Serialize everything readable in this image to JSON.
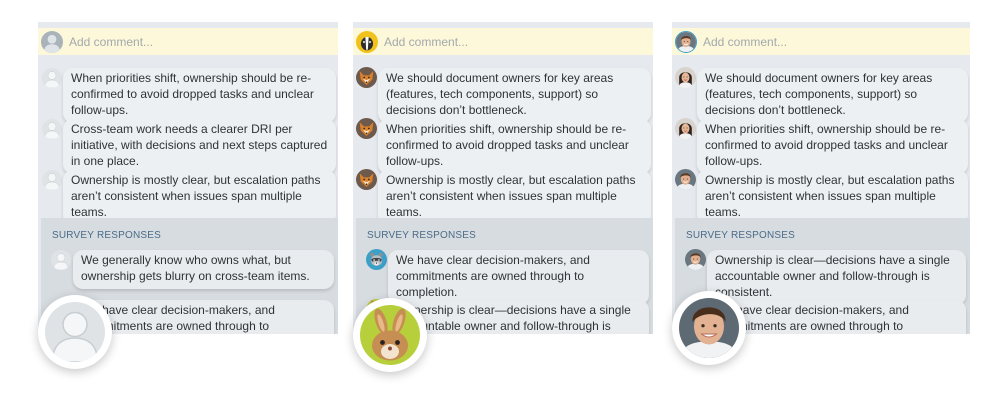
{
  "panels": [
    {
      "theme": "anonymous",
      "placeholder": "Add comment...",
      "comments": [
        {
          "avatar": "anonymous-avatar-icon",
          "text": "When priorities shift, ownership should be re-confirmed to avoid dropped tasks and unclear follow-ups."
        },
        {
          "avatar": "anonymous-avatar-icon",
          "text": "Cross-team work needs a clearer DRI per initiative, with decisions and next steps captured in one place."
        },
        {
          "avatar": "anonymous-avatar-icon",
          "text": "Ownership is mostly clear, but escalation paths aren’t consistent when issues span multiple teams."
        }
      ],
      "survey_label": "SURVEY RESPONSES",
      "survey": [
        {
          "avatar": "anonymous-avatar-icon",
          "text": "We generally know who owns what, but ownership gets blurry on cross-team items."
        },
        {
          "avatar": "anonymous-avatar-icon",
          "text": "We have clear decision-makers, and commitments are owned through to completion."
        }
      ]
    },
    {
      "theme": "animal",
      "placeholder": "Add comment...",
      "comments": [
        {
          "avatar": "fox-avatar-icon",
          "text": "We should document owners for key areas (features, tech components, support) so decisions don’t bottleneck."
        },
        {
          "avatar": "fox-avatar-icon",
          "text": "When priorities shift, ownership should be re-confirmed to avoid dropped tasks and unclear follow-ups."
        },
        {
          "avatar": "fox-avatar-icon",
          "text": "Ownership is mostly clear, but escalation paths aren’t consistent when issues span multiple teams."
        }
      ],
      "survey_label": "SURVEY RESPONSES",
      "survey": [
        {
          "avatar": "raccoon-avatar-icon",
          "text": "We have clear decision-makers, and commitments are owned through to completion."
        },
        {
          "avatar": "rabbit-avatar-icon",
          "text": "Ownership is clear—decisions have a single accountable owner and follow-through is consistent."
        }
      ]
    },
    {
      "theme": "photo",
      "placeholder": "Add comment...",
      "comments": [
        {
          "avatar": "woman-photo-avatar-icon",
          "text": "We should document owners for key areas (features, tech components, support) so decisions don’t bottleneck."
        },
        {
          "avatar": "woman-photo-avatar-icon",
          "text": "When priorities shift, ownership should be re-confirmed to avoid dropped tasks and unclear follow-ups."
        },
        {
          "avatar": "man-photo-avatar-icon",
          "text": "Ownership is mostly clear, but escalation paths aren’t consistent when issues span multiple teams."
        }
      ],
      "survey_label": "SURVEY RESPONSES",
      "survey": [
        {
          "avatar": "man-photo-avatar-icon",
          "text": "Ownership is clear—decisions have a single accountable owner and follow-through is consistent."
        },
        {
          "avatar": "man-photo-avatar-icon",
          "text": "We have clear decision-makers, and commitments are owned through to completion."
        }
      ]
    }
  ],
  "colors": {
    "comment_bar": "#fdf8d9",
    "panel_bg": "#e6eaee",
    "survey_bg": "#d7dce0",
    "survey_label": "#4a6b88",
    "bubble_bg": "#edf0f2"
  }
}
